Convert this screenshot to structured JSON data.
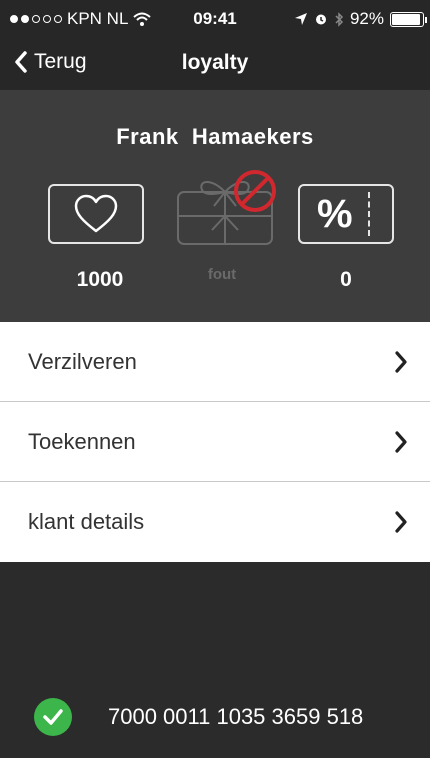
{
  "status_bar": {
    "carrier": "KPN NL",
    "time": "09:41",
    "battery": "92%",
    "battery_level": 0.92,
    "signal_bars": 2
  },
  "nav": {
    "back_label": "Terug",
    "title": "loyalty"
  },
  "customer": {
    "name": "Frank  Hamaekers",
    "points": "1000",
    "gift_status": "fout",
    "discount": "0"
  },
  "menu": {
    "items": [
      {
        "label": "Verzilveren"
      },
      {
        "label": "Toekennen"
      },
      {
        "label": "klant details"
      }
    ]
  },
  "footer": {
    "card_number": "7000 0011 1035 3659 518"
  },
  "colors": {
    "dark_bar": "#272727",
    "card_bg": "#3d3d3d",
    "success_green": "#3cb54a",
    "error_red": "#d0282e"
  }
}
